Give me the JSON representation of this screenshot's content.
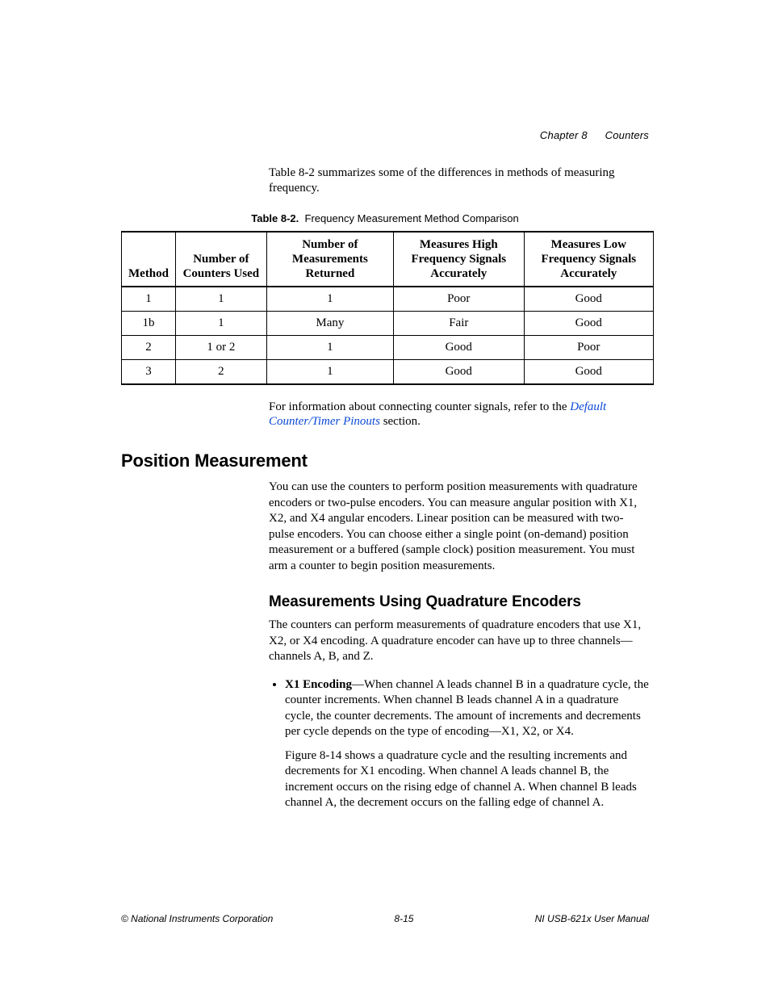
{
  "header": {
    "chapter_label": "Chapter 8",
    "chapter_title": "Counters"
  },
  "intro": "Table 8-2 summarizes some of the differences in methods of measuring frequency.",
  "table": {
    "caption_number": "Table 8-2.",
    "caption_text": "Frequency Measurement Method Comparison",
    "headers": [
      "Method",
      "Number of Counters Used",
      "Number of Measurements Returned",
      "Measures High Frequency Signals Accurately",
      "Measures Low Frequency Signals Accurately"
    ],
    "rows": [
      [
        "1",
        "1",
        "1",
        "Poor",
        "Good"
      ],
      [
        "1b",
        "1",
        "Many",
        "Fair",
        "Good"
      ],
      [
        "2",
        "1 or 2",
        "1",
        "Good",
        "Poor"
      ],
      [
        "3",
        "2",
        "1",
        "Good",
        "Good"
      ]
    ]
  },
  "post_table": {
    "pre_link": "For information about connecting counter signals, refer to the ",
    "link_text": "Default Counter/Timer Pinouts",
    "post_link": " section."
  },
  "section_h2": "Position Measurement",
  "position_para": "You can use the counters to perform position measurements with quadrature encoders or two-pulse encoders. You can measure angular position with X1, X2, and X4 angular encoders. Linear position can be measured with two-pulse encoders. You can choose either a single point (on-demand) position measurement or a buffered (sample clock) position measurement. You must arm a counter to begin position measurements.",
  "subsection_h3": "Measurements Using Quadrature Encoders",
  "quad_para": "The counters can perform measurements of quadrature encoders that use X1, X2, or X4 encoding. A quadrature encoder can have up to three channels—channels A, B, and Z.",
  "bullet": {
    "lead_bold": "X1 Encoding",
    "lead_rest": "—When channel A leads channel B in a quadrature cycle, the counter increments. When channel B leads channel A in a quadrature cycle, the counter decrements. The amount of increments and decrements per cycle depends on the type of encoding—X1, X2, or X4.",
    "follow": "Figure 8-14 shows a quadrature cycle and the resulting increments and decrements for X1 encoding. When channel A leads channel B, the increment occurs on the rising edge of channel A. When channel B leads channel A, the decrement occurs on the falling edge of channel A."
  },
  "footer": {
    "left": "© National Instruments Corporation",
    "center": "8-15",
    "right": "NI USB-621x User Manual"
  }
}
